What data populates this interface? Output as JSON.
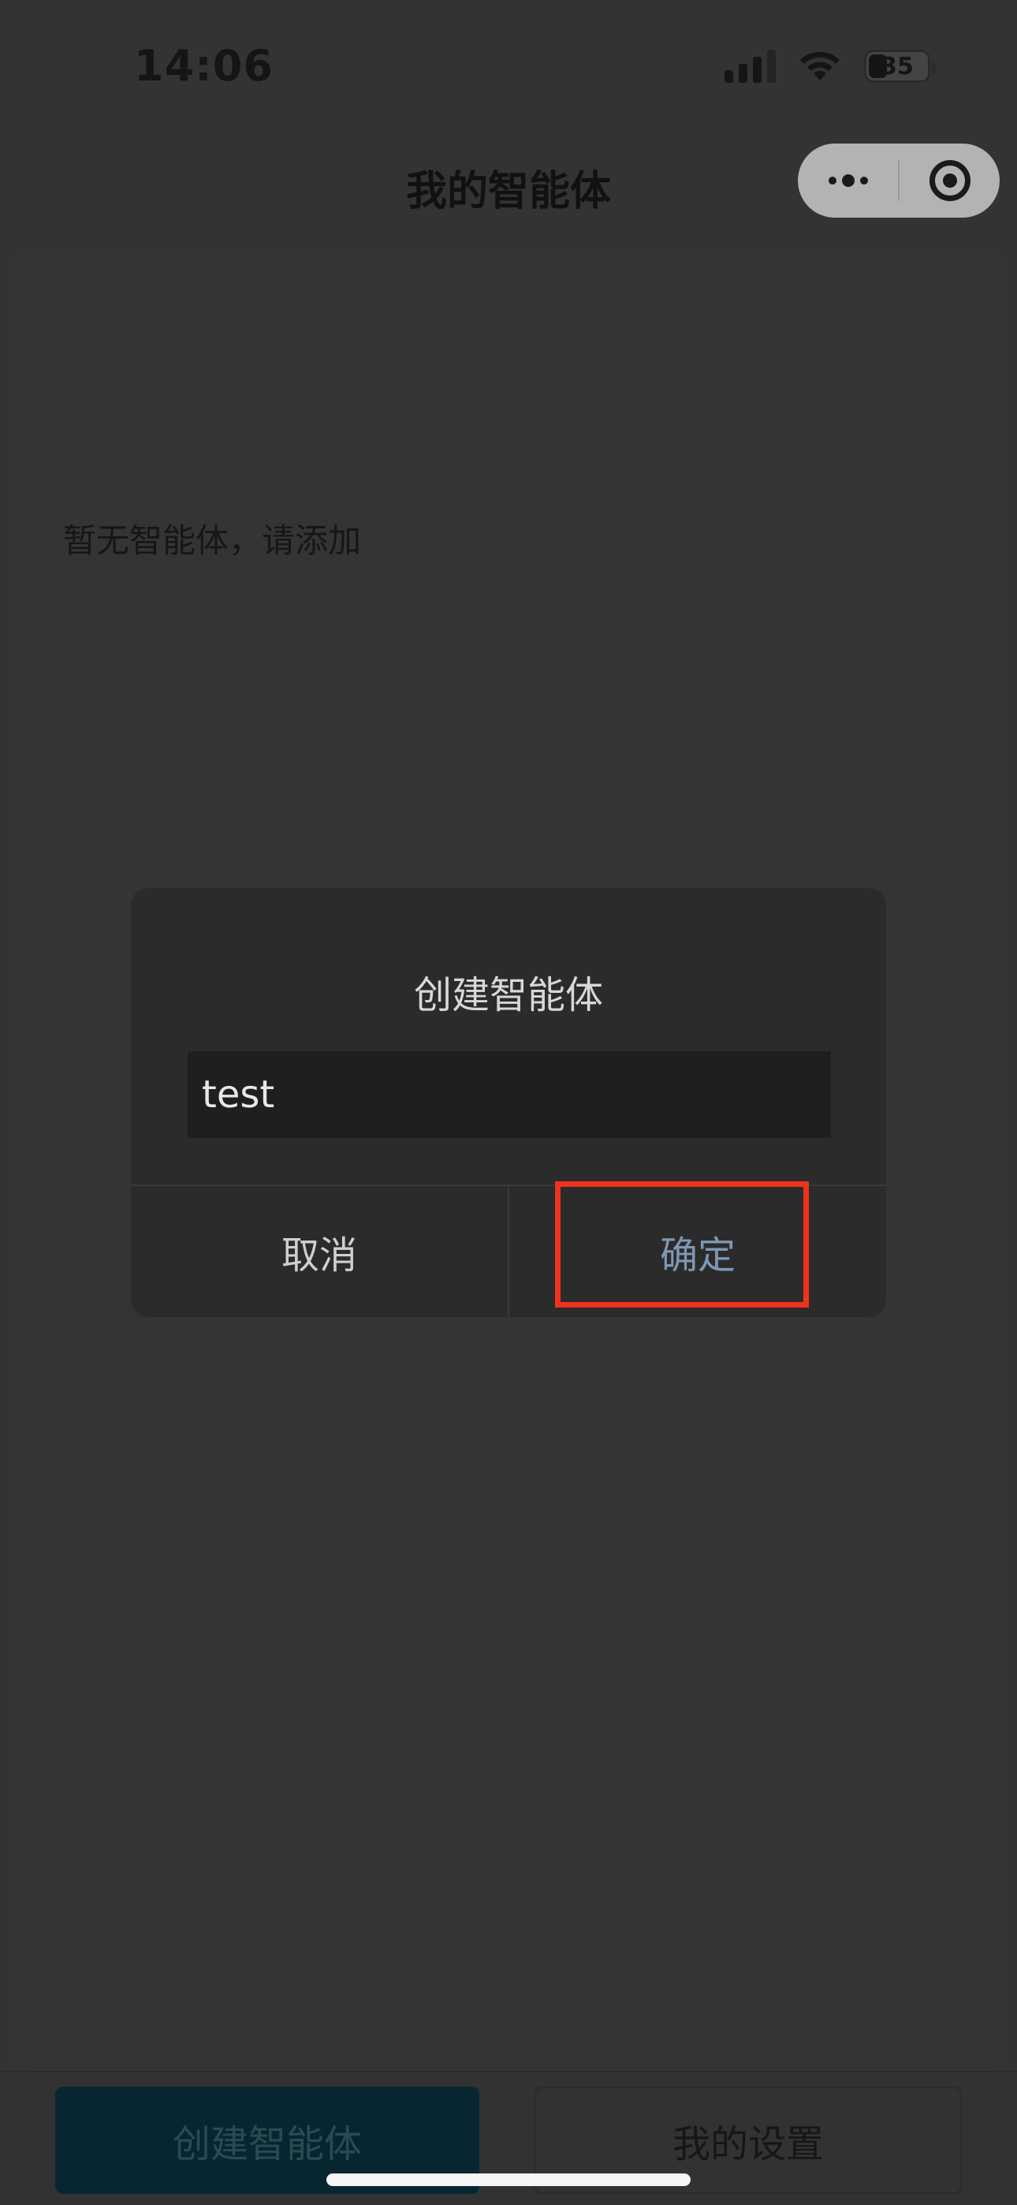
{
  "status_bar": {
    "time": "14:06",
    "battery": "35",
    "icons": [
      "signal-icon",
      "wifi-icon",
      "battery-icon"
    ]
  },
  "nav": {
    "title": "我的智能体",
    "capsule_icons": [
      "more-icon",
      "close-icon"
    ]
  },
  "main": {
    "empty_message": "暂无智能体，请添加"
  },
  "dialog": {
    "title": "创建智能体",
    "input_value": "test",
    "cancel_label": "取消",
    "confirm_label": "确定"
  },
  "bottom_tabs": {
    "create_label": "创建智能体",
    "settings_label": "我的设置"
  },
  "colors": {
    "background": "#333333",
    "dialog_bg": "#2b2b2b",
    "confirm_text": "#7e98b3",
    "highlight": "#f0321c",
    "create_tab_bg": "#082630"
  }
}
